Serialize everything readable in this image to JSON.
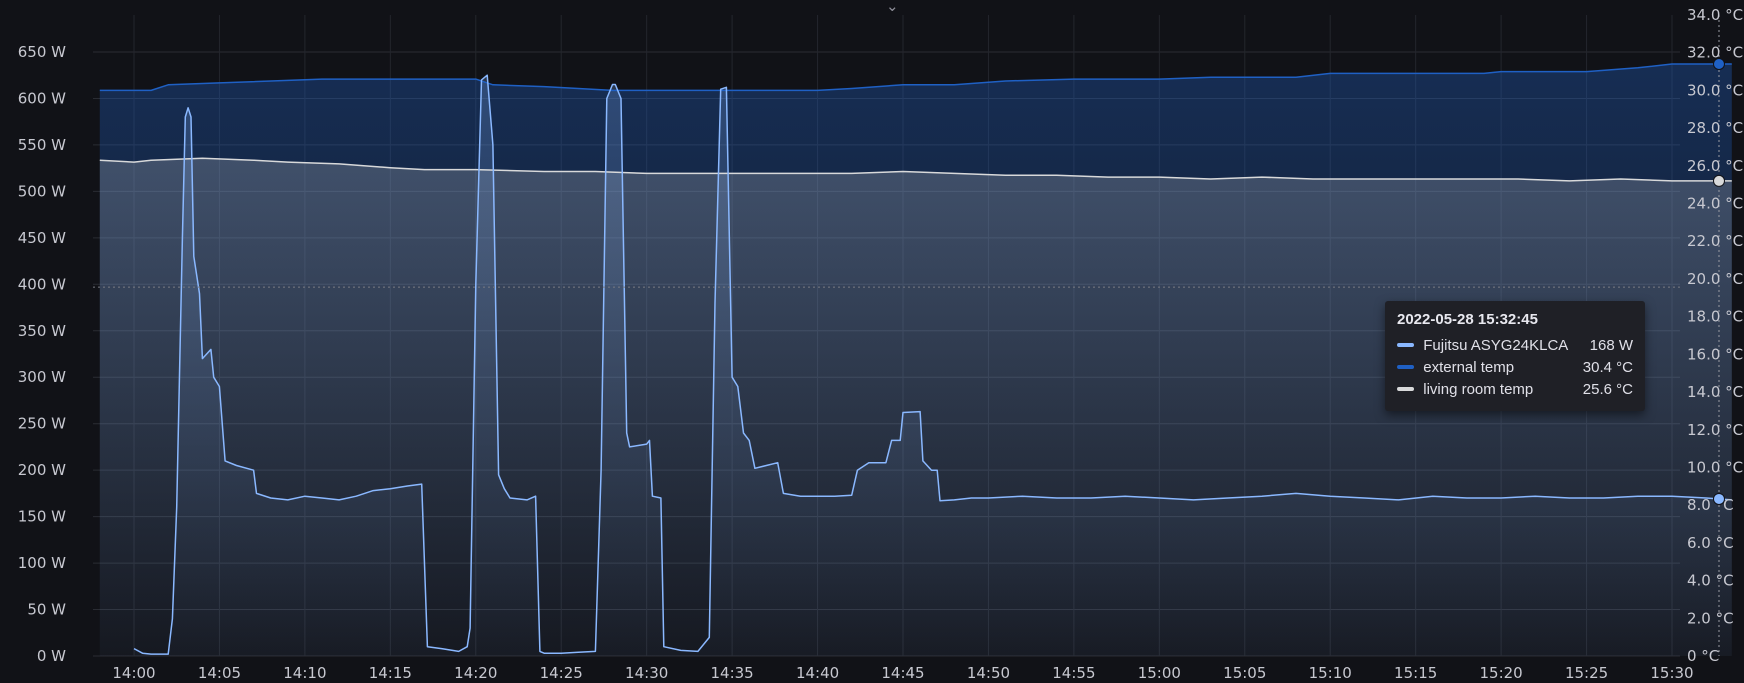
{
  "chart_data": {
    "type": "line",
    "title": "",
    "y_left": {
      "unit": "W",
      "ylim": [
        0,
        700
      ],
      "ticks": [
        "0 W",
        "50 W",
        "100 W",
        "150 W",
        "200 W",
        "250 W",
        "300 W",
        "350 W",
        "400 W",
        "450 W",
        "500 W",
        "550 W",
        "600 W",
        "650 W"
      ]
    },
    "y_right": {
      "unit": "°C",
      "ylim": [
        0,
        34
      ],
      "ticks": [
        "0 °C",
        "2.0 °C",
        "4.0 °C",
        "6.0 °C",
        "8.0 °C",
        "10.0 °C",
        "12.0 °C",
        "14.0 °C",
        "16.0 °C",
        "18.0 °C",
        "20.0 °C",
        "22.0 °C",
        "24.0 °C",
        "26.0 °C",
        "28.0 °C",
        "30.0 °C",
        "32.0 °C",
        "34.0 °C"
      ]
    },
    "x_ticks": [
      "14:00",
      "14:05",
      "14:10",
      "14:15",
      "14:20",
      "14:25",
      "14:30",
      "14:35",
      "14:40",
      "14:45",
      "14:50",
      "14:55",
      "15:00",
      "15:05",
      "15:10",
      "15:15",
      "15:20",
      "15:25",
      "15:30"
    ],
    "x_range": [
      "13:58",
      "15:33:30"
    ],
    "grid": true,
    "crosshair": {
      "time": "15:32:45",
      "y_value_w": 397
    },
    "series": [
      {
        "name": "Fujitsu ASYG24KLCA",
        "axis": "left",
        "color": "#8ab8ff",
        "points": [
          [
            "14:00",
            8
          ],
          [
            "14:00:30",
            3
          ],
          [
            "14:01",
            2
          ],
          [
            "14:02",
            2
          ],
          [
            "14:02:15",
            40
          ],
          [
            "14:02:30",
            160
          ],
          [
            "14:02:50",
            450
          ],
          [
            "14:03",
            580
          ],
          [
            "14:03:10",
            590
          ],
          [
            "14:03:20",
            580
          ],
          [
            "14:03:30",
            430
          ],
          [
            "14:03:50",
            390
          ],
          [
            "14:04",
            320
          ],
          [
            "14:04:30",
            330
          ],
          [
            "14:04:40",
            300
          ],
          [
            "14:05",
            290
          ],
          [
            "14:05:20",
            210
          ],
          [
            "14:06",
            205
          ],
          [
            "14:07",
            200
          ],
          [
            "14:07:10",
            175
          ],
          [
            "14:08",
            170
          ],
          [
            "14:09",
            168
          ],
          [
            "14:10",
            172
          ],
          [
            "14:11",
            170
          ],
          [
            "14:12",
            168
          ],
          [
            "14:13",
            172
          ],
          [
            "14:14",
            178
          ],
          [
            "14:15",
            180
          ],
          [
            "14:16",
            183
          ],
          [
            "14:16:50",
            185
          ],
          [
            "14:17:10",
            10
          ],
          [
            "14:18",
            8
          ],
          [
            "14:19",
            5
          ],
          [
            "14:19:30",
            10
          ],
          [
            "14:19:40",
            30
          ],
          [
            "14:20",
            400
          ],
          [
            "14:20:20",
            620
          ],
          [
            "14:20:40",
            625
          ],
          [
            "14:21",
            550
          ],
          [
            "14:21:20",
            195
          ],
          [
            "14:21:40",
            180
          ],
          [
            "14:22",
            170
          ],
          [
            "14:23",
            168
          ],
          [
            "14:23:30",
            172
          ],
          [
            "14:23:45",
            5
          ],
          [
            "14:24",
            3
          ],
          [
            "14:25",
            3
          ],
          [
            "14:26",
            4
          ],
          [
            "14:27",
            5
          ],
          [
            "14:27:20",
            200
          ],
          [
            "14:27:40",
            600
          ],
          [
            "14:28",
            615
          ],
          [
            "14:28:10",
            615
          ],
          [
            "14:28:30",
            600
          ],
          [
            "14:28:50",
            240
          ],
          [
            "14:29",
            225
          ],
          [
            "14:30",
            228
          ],
          [
            "14:30:10",
            232
          ],
          [
            "14:30:20",
            172
          ],
          [
            "14:30:50",
            170
          ],
          [
            "14:31",
            10
          ],
          [
            "14:32",
            6
          ],
          [
            "14:33",
            5
          ],
          [
            "14:33:40",
            20
          ],
          [
            "14:34",
            380
          ],
          [
            "14:34:20",
            610
          ],
          [
            "14:34:40",
            612
          ],
          [
            "14:35",
            300
          ],
          [
            "14:35:20",
            290
          ],
          [
            "14:35:40",
            240
          ],
          [
            "14:36",
            232
          ],
          [
            "14:36:20",
            202
          ],
          [
            "14:37",
            205
          ],
          [
            "14:37:40",
            208
          ],
          [
            "14:38",
            175
          ],
          [
            "14:39",
            172
          ],
          [
            "14:40",
            172
          ],
          [
            "14:41",
            172
          ],
          [
            "14:42",
            173
          ],
          [
            "14:42:20",
            200
          ],
          [
            "14:43",
            208
          ],
          [
            "14:44",
            208
          ],
          [
            "14:44:20",
            232
          ],
          [
            "14:44:50",
            232
          ],
          [
            "14:45",
            262
          ],
          [
            "14:46",
            263
          ],
          [
            "14:46:10",
            210
          ],
          [
            "14:46:40",
            200
          ],
          [
            "14:47",
            200
          ],
          [
            "14:47:10",
            167
          ],
          [
            "14:48",
            168
          ],
          [
            "14:49",
            170
          ],
          [
            "14:50",
            170
          ],
          [
            "14:52",
            172
          ],
          [
            "14:54",
            170
          ],
          [
            "14:56",
            170
          ],
          [
            "14:58",
            172
          ],
          [
            "15:00",
            170
          ],
          [
            "15:02",
            168
          ],
          [
            "15:04",
            170
          ],
          [
            "15:06",
            172
          ],
          [
            "15:08",
            175
          ],
          [
            "15:10",
            172
          ],
          [
            "15:12",
            170
          ],
          [
            "15:14",
            168
          ],
          [
            "15:16",
            172
          ],
          [
            "15:18",
            170
          ],
          [
            "15:20",
            170
          ],
          [
            "15:22",
            172
          ],
          [
            "15:24",
            170
          ],
          [
            "15:26",
            170
          ],
          [
            "15:28",
            172
          ],
          [
            "15:30",
            172
          ],
          [
            "15:32",
            170
          ],
          [
            "15:33:30",
            168
          ]
        ]
      },
      {
        "name": "external temp",
        "axis": "right",
        "color": "#1f60c4",
        "points": [
          [
            "13:58",
            30.0
          ],
          [
            "14:01",
            30.0
          ],
          [
            "14:02",
            30.3
          ],
          [
            "14:05",
            30.4
          ],
          [
            "14:11",
            30.6
          ],
          [
            "14:20",
            30.6
          ],
          [
            "14:21",
            30.3
          ],
          [
            "14:24",
            30.2
          ],
          [
            "14:28",
            30.0
          ],
          [
            "14:32",
            30.0
          ],
          [
            "14:40",
            30.0
          ],
          [
            "14:42",
            30.1
          ],
          [
            "14:45",
            30.3
          ],
          [
            "14:48",
            30.3
          ],
          [
            "14:51",
            30.5
          ],
          [
            "14:55",
            30.6
          ],
          [
            "15:00",
            30.6
          ],
          [
            "15:03",
            30.7
          ],
          [
            "15:08",
            30.7
          ],
          [
            "15:10",
            30.9
          ],
          [
            "15:15",
            30.9
          ],
          [
            "15:19",
            30.9
          ],
          [
            "15:20",
            31.0
          ],
          [
            "15:25",
            31.0
          ],
          [
            "15:28",
            31.2
          ],
          [
            "15:30",
            31.4
          ],
          [
            "15:33:30",
            31.4
          ]
        ]
      },
      {
        "name": "living room temp",
        "axis": "right",
        "color": "#d8d9da",
        "points": [
          [
            "13:58",
            26.3
          ],
          [
            "14:00",
            26.2
          ],
          [
            "14:01",
            26.3
          ],
          [
            "14:04",
            26.4
          ],
          [
            "14:07",
            26.3
          ],
          [
            "14:09",
            26.2
          ],
          [
            "14:12",
            26.1
          ],
          [
            "14:15",
            25.9
          ],
          [
            "14:17",
            25.8
          ],
          [
            "14:20",
            25.8
          ],
          [
            "14:24",
            25.7
          ],
          [
            "14:27",
            25.7
          ],
          [
            "14:30",
            25.6
          ],
          [
            "14:33",
            25.6
          ],
          [
            "14:36",
            25.6
          ],
          [
            "14:39",
            25.6
          ],
          [
            "14:42",
            25.6
          ],
          [
            "14:45",
            25.7
          ],
          [
            "14:48",
            25.6
          ],
          [
            "14:51",
            25.5
          ],
          [
            "14:54",
            25.5
          ],
          [
            "14:57",
            25.4
          ],
          [
            "15:00",
            25.4
          ],
          [
            "15:03",
            25.3
          ],
          [
            "15:06",
            25.4
          ],
          [
            "15:09",
            25.3
          ],
          [
            "15:12",
            25.3
          ],
          [
            "15:15",
            25.3
          ],
          [
            "15:18",
            25.3
          ],
          [
            "15:21",
            25.3
          ],
          [
            "15:24",
            25.2
          ],
          [
            "15:27",
            25.3
          ],
          [
            "15:30",
            25.2
          ],
          [
            "15:33:30",
            25.2
          ]
        ]
      }
    ]
  },
  "tooltip": {
    "time": "2022-05-28 15:32:45",
    "rows": [
      {
        "name": "Fujitsu ASYG24KLCA",
        "value": "168 W",
        "color": "#8ab8ff"
      },
      {
        "name": "external temp",
        "value": "30.4 °C",
        "color": "#1f60c4"
      },
      {
        "name": "living room temp",
        "value": "25.6 °C",
        "color": "#d8d9da"
      }
    ]
  },
  "header": {
    "collapse_icon": "chevron-down-icon"
  }
}
